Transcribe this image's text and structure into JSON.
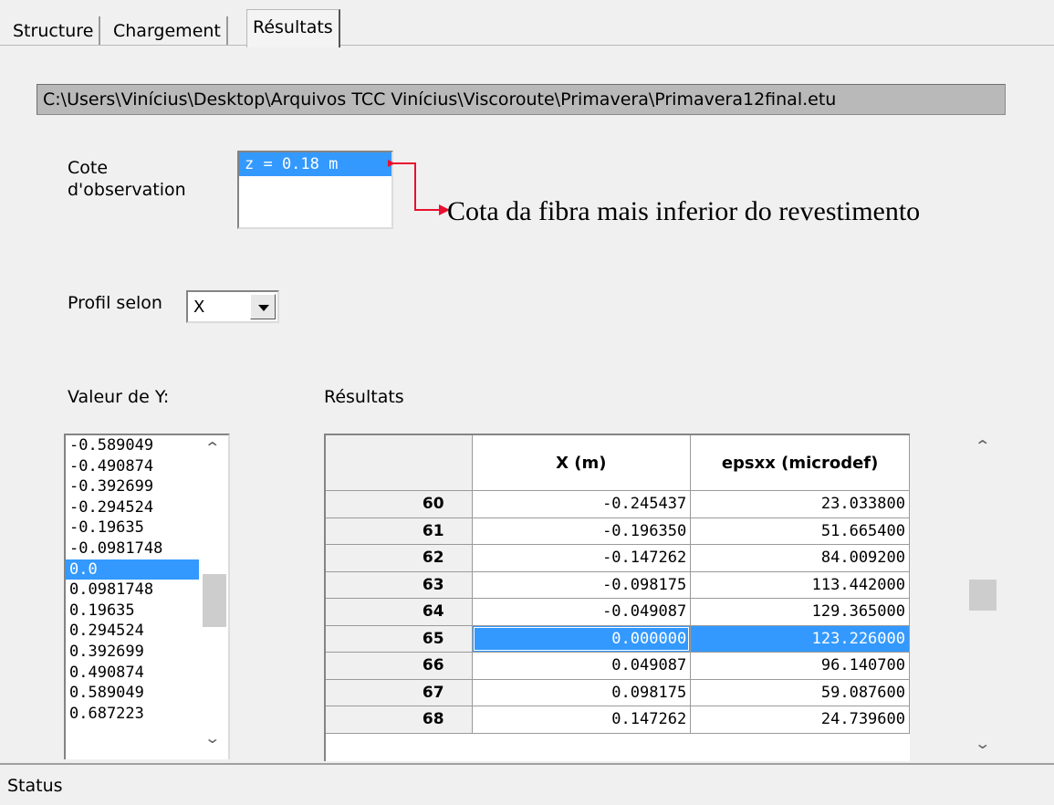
{
  "tabs": [
    {
      "label": "Structure"
    },
    {
      "label": "Chargement"
    },
    {
      "label": "Résultats"
    }
  ],
  "file_path": "C:\\Users\\Vinícius\\Desktop\\Arquivos TCC Vinícius\\Viscoroute\\Primavera\\Primavera12final.etu",
  "cote": {
    "label_line1": "Cote",
    "label_line2": "d'observation",
    "selected": "z = 0.18 m"
  },
  "annotation": "Cota da fibra mais inferior do revestimento",
  "profil": {
    "label": "Profil selon",
    "value": "X"
  },
  "y_values": {
    "label": "Valeur de Y:",
    "items": [
      "-0.589049",
      "-0.490874",
      "-0.392699",
      "-0.294524",
      "-0.19635",
      "-0.0981748",
      "0.0",
      "0.0981748",
      "0.19635",
      "0.294524",
      "0.392699",
      "0.490874",
      "0.589049",
      "0.687223"
    ],
    "selected": "0.0"
  },
  "results": {
    "label": "Résultats",
    "columns": [
      "",
      "X (m)",
      "epsxx (microdef)"
    ],
    "rows": [
      {
        "id": "60",
        "x": "-0.245437",
        "eps": "23.033800"
      },
      {
        "id": "61",
        "x": "-0.196350",
        "eps": "51.665400"
      },
      {
        "id": "62",
        "x": "-0.147262",
        "eps": "84.009200"
      },
      {
        "id": "63",
        "x": "-0.098175",
        "eps": "113.442000"
      },
      {
        "id": "64",
        "x": "-0.049087",
        "eps": "129.365000"
      },
      {
        "id": "65",
        "x": "0.000000",
        "eps": "123.226000"
      },
      {
        "id": "66",
        "x": "0.049087",
        "eps": "96.140700"
      },
      {
        "id": "67",
        "x": "0.098175",
        "eps": "59.087600"
      },
      {
        "id": "68",
        "x": "0.147262",
        "eps": "24.739600"
      }
    ],
    "selected_row": "65"
  },
  "status": "Status",
  "colors": {
    "selection": "#3399ff",
    "annotation_arrow": "#e8102e"
  },
  "icons": {
    "scroll_up": "chevron-up-icon",
    "scroll_down": "chevron-down-icon",
    "dropdown": "triangle-down-icon"
  }
}
